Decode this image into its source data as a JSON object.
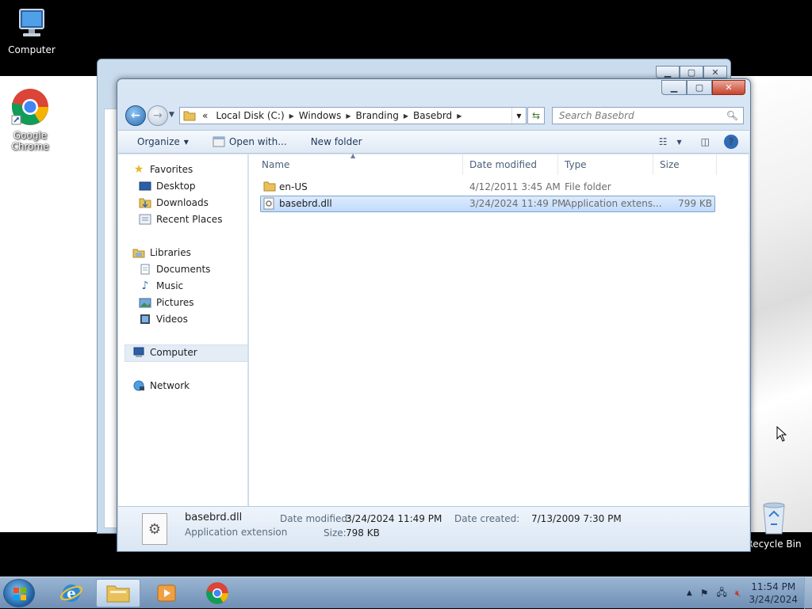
{
  "desktop": {
    "icons": {
      "computer": "Computer",
      "chrome": "Google Chrome",
      "recycle_bin": "Recycle Bin"
    }
  },
  "window": {
    "address": {
      "overflow": "«",
      "segments": [
        "Local Disk (C:)",
        "Windows",
        "Branding",
        "Basebrd"
      ]
    },
    "search_placeholder": "Search Basebrd",
    "toolbar": {
      "organize": "Organize",
      "open_with": "Open with...",
      "new_folder": "New folder"
    },
    "nav": {
      "favorites": "Favorites",
      "desktop": "Desktop",
      "downloads": "Downloads",
      "recent_places": "Recent Places",
      "libraries": "Libraries",
      "documents": "Documents",
      "music": "Music",
      "pictures": "Pictures",
      "videos": "Videos",
      "computer": "Computer",
      "network": "Network"
    },
    "columns": {
      "name": "Name",
      "date_modified": "Date modified",
      "type": "Type",
      "size": "Size"
    },
    "files": [
      {
        "name": "en-US",
        "date": "4/12/2011 3:45 AM",
        "type": "File folder",
        "size": ""
      },
      {
        "name": "basebrd.dll",
        "date": "3/24/2024 11:49 PM",
        "type": "Application extens...",
        "size": "799 KB"
      }
    ],
    "details": {
      "name": "basebrd.dll",
      "kind": "Application extension",
      "date_modified_label": "Date modified:",
      "date_modified": "3/24/2024 11:49 PM",
      "size_label": "Size:",
      "size": "798 KB",
      "date_created_label": "Date created:",
      "date_created": "7/13/2009 7:30 PM"
    }
  },
  "taskbar": {
    "clock_time": "11:54 PM",
    "clock_date": "3/24/2024"
  }
}
